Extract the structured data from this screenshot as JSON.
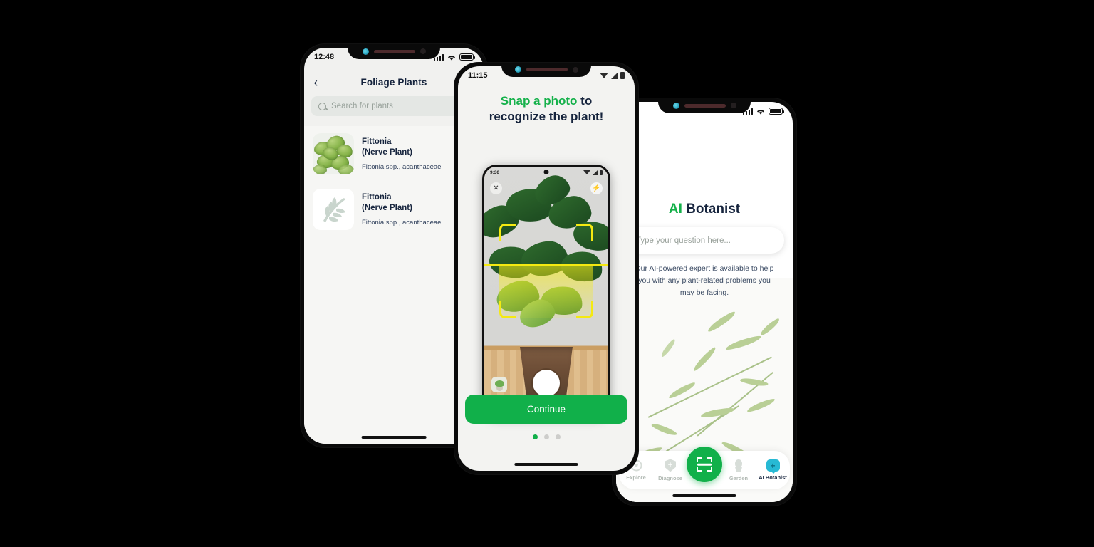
{
  "background_color": "#000000",
  "brand": {
    "green": "#11b04a",
    "cyan": "#27b9d4",
    "yellow": "#f4e911",
    "navy": "#16243d"
  },
  "left_phone": {
    "status": {
      "time": "12:48",
      "icons": [
        "signal-bars",
        "wifi",
        "battery"
      ]
    },
    "nav": {
      "back_icon": "chevron-left-icon",
      "title": "Foliage Plants"
    },
    "search": {
      "icon": "search-icon",
      "placeholder": "Search for plants",
      "value": ""
    },
    "list": [
      {
        "name": "Fittonia\n(Nerve Plant)",
        "name_line1": "Fittonia",
        "name_line2": "(Nerve Plant)",
        "sci": "Fittonia spp., acanthaceae",
        "thumb": "fittonia-photo"
      },
      {
        "name": "Fittonia\n(Nerve Plant)",
        "name_line1": "Fittonia",
        "name_line2": "(Nerve Plant)",
        "sci": "Fittonia spp., acanthaceae",
        "thumb": "leaf-placeholder-icon"
      }
    ]
  },
  "center_phone": {
    "status": {
      "time": "11:15",
      "icons": [
        "wifi",
        "signal",
        "battery"
      ]
    },
    "headline": {
      "highlight": "Snap a photo",
      "rest": " to",
      "line2": "recognize the plant!"
    },
    "mockup": {
      "status_time": "9:30",
      "close_icon": "close-icon",
      "flash_icon": "flash-icon",
      "gallery_icon": "gallery-thumbnail-icon",
      "shutter_icon": "camera-shutter-button",
      "scan_frame": "yellow-scan-brackets"
    },
    "continue_label": "Continue",
    "pager": {
      "total": 3,
      "active": 1
    }
  },
  "right_phone": {
    "status": {
      "icons": [
        "signal-bars",
        "wifi",
        "battery"
      ]
    },
    "title": {
      "highlight": "AI",
      "rest": " Botanist"
    },
    "input": {
      "placeholder": "Type your question here...",
      "value": ""
    },
    "description": "Our AI-powered expert is available to help you with any plant-related problems you may be facing.",
    "tabbar": [
      {
        "label": "Explore",
        "icon": "explore-icon",
        "active": false
      },
      {
        "label": "Diagnose",
        "icon": "shield-plus-icon",
        "active": false
      },
      {
        "label": "",
        "icon": "scan-icon",
        "active": false,
        "is_fab": true
      },
      {
        "label": "Garden",
        "icon": "plant-pot-icon",
        "active": false
      },
      {
        "label": "AI Botanist",
        "icon": "chat-bubble-plus-icon",
        "active": true
      }
    ]
  }
}
